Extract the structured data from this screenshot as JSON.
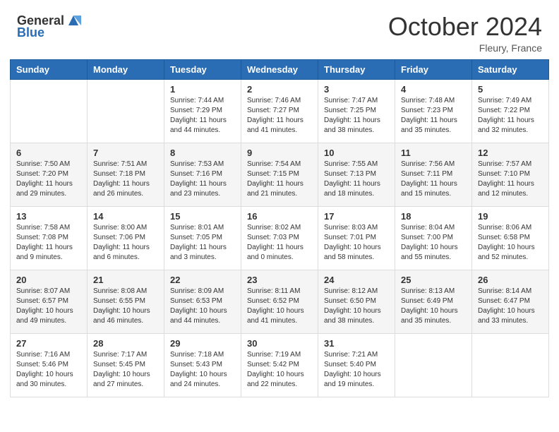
{
  "logo": {
    "general": "General",
    "blue": "Blue"
  },
  "header": {
    "month": "October 2024",
    "location": "Fleury, France"
  },
  "weekdays": [
    "Sunday",
    "Monday",
    "Tuesday",
    "Wednesday",
    "Thursday",
    "Friday",
    "Saturday"
  ],
  "weeks": [
    [
      {
        "day": "",
        "sunrise": "",
        "sunset": "",
        "daylight": ""
      },
      {
        "day": "",
        "sunrise": "",
        "sunset": "",
        "daylight": ""
      },
      {
        "day": "1",
        "sunrise": "Sunrise: 7:44 AM",
        "sunset": "Sunset: 7:29 PM",
        "daylight": "Daylight: 11 hours and 44 minutes."
      },
      {
        "day": "2",
        "sunrise": "Sunrise: 7:46 AM",
        "sunset": "Sunset: 7:27 PM",
        "daylight": "Daylight: 11 hours and 41 minutes."
      },
      {
        "day": "3",
        "sunrise": "Sunrise: 7:47 AM",
        "sunset": "Sunset: 7:25 PM",
        "daylight": "Daylight: 11 hours and 38 minutes."
      },
      {
        "day": "4",
        "sunrise": "Sunrise: 7:48 AM",
        "sunset": "Sunset: 7:23 PM",
        "daylight": "Daylight: 11 hours and 35 minutes."
      },
      {
        "day": "5",
        "sunrise": "Sunrise: 7:49 AM",
        "sunset": "Sunset: 7:22 PM",
        "daylight": "Daylight: 11 hours and 32 minutes."
      }
    ],
    [
      {
        "day": "6",
        "sunrise": "Sunrise: 7:50 AM",
        "sunset": "Sunset: 7:20 PM",
        "daylight": "Daylight: 11 hours and 29 minutes."
      },
      {
        "day": "7",
        "sunrise": "Sunrise: 7:51 AM",
        "sunset": "Sunset: 7:18 PM",
        "daylight": "Daylight: 11 hours and 26 minutes."
      },
      {
        "day": "8",
        "sunrise": "Sunrise: 7:53 AM",
        "sunset": "Sunset: 7:16 PM",
        "daylight": "Daylight: 11 hours and 23 minutes."
      },
      {
        "day": "9",
        "sunrise": "Sunrise: 7:54 AM",
        "sunset": "Sunset: 7:15 PM",
        "daylight": "Daylight: 11 hours and 21 minutes."
      },
      {
        "day": "10",
        "sunrise": "Sunrise: 7:55 AM",
        "sunset": "Sunset: 7:13 PM",
        "daylight": "Daylight: 11 hours and 18 minutes."
      },
      {
        "day": "11",
        "sunrise": "Sunrise: 7:56 AM",
        "sunset": "Sunset: 7:11 PM",
        "daylight": "Daylight: 11 hours and 15 minutes."
      },
      {
        "day": "12",
        "sunrise": "Sunrise: 7:57 AM",
        "sunset": "Sunset: 7:10 PM",
        "daylight": "Daylight: 11 hours and 12 minutes."
      }
    ],
    [
      {
        "day": "13",
        "sunrise": "Sunrise: 7:58 AM",
        "sunset": "Sunset: 7:08 PM",
        "daylight": "Daylight: 11 hours and 9 minutes."
      },
      {
        "day": "14",
        "sunrise": "Sunrise: 8:00 AM",
        "sunset": "Sunset: 7:06 PM",
        "daylight": "Daylight: 11 hours and 6 minutes."
      },
      {
        "day": "15",
        "sunrise": "Sunrise: 8:01 AM",
        "sunset": "Sunset: 7:05 PM",
        "daylight": "Daylight: 11 hours and 3 minutes."
      },
      {
        "day": "16",
        "sunrise": "Sunrise: 8:02 AM",
        "sunset": "Sunset: 7:03 PM",
        "daylight": "Daylight: 11 hours and 0 minutes."
      },
      {
        "day": "17",
        "sunrise": "Sunrise: 8:03 AM",
        "sunset": "Sunset: 7:01 PM",
        "daylight": "Daylight: 10 hours and 58 minutes."
      },
      {
        "day": "18",
        "sunrise": "Sunrise: 8:04 AM",
        "sunset": "Sunset: 7:00 PM",
        "daylight": "Daylight: 10 hours and 55 minutes."
      },
      {
        "day": "19",
        "sunrise": "Sunrise: 8:06 AM",
        "sunset": "Sunset: 6:58 PM",
        "daylight": "Daylight: 10 hours and 52 minutes."
      }
    ],
    [
      {
        "day": "20",
        "sunrise": "Sunrise: 8:07 AM",
        "sunset": "Sunset: 6:57 PM",
        "daylight": "Daylight: 10 hours and 49 minutes."
      },
      {
        "day": "21",
        "sunrise": "Sunrise: 8:08 AM",
        "sunset": "Sunset: 6:55 PM",
        "daylight": "Daylight: 10 hours and 46 minutes."
      },
      {
        "day": "22",
        "sunrise": "Sunrise: 8:09 AM",
        "sunset": "Sunset: 6:53 PM",
        "daylight": "Daylight: 10 hours and 44 minutes."
      },
      {
        "day": "23",
        "sunrise": "Sunrise: 8:11 AM",
        "sunset": "Sunset: 6:52 PM",
        "daylight": "Daylight: 10 hours and 41 minutes."
      },
      {
        "day": "24",
        "sunrise": "Sunrise: 8:12 AM",
        "sunset": "Sunset: 6:50 PM",
        "daylight": "Daylight: 10 hours and 38 minutes."
      },
      {
        "day": "25",
        "sunrise": "Sunrise: 8:13 AM",
        "sunset": "Sunset: 6:49 PM",
        "daylight": "Daylight: 10 hours and 35 minutes."
      },
      {
        "day": "26",
        "sunrise": "Sunrise: 8:14 AM",
        "sunset": "Sunset: 6:47 PM",
        "daylight": "Daylight: 10 hours and 33 minutes."
      }
    ],
    [
      {
        "day": "27",
        "sunrise": "Sunrise: 7:16 AM",
        "sunset": "Sunset: 5:46 PM",
        "daylight": "Daylight: 10 hours and 30 minutes."
      },
      {
        "day": "28",
        "sunrise": "Sunrise: 7:17 AM",
        "sunset": "Sunset: 5:45 PM",
        "daylight": "Daylight: 10 hours and 27 minutes."
      },
      {
        "day": "29",
        "sunrise": "Sunrise: 7:18 AM",
        "sunset": "Sunset: 5:43 PM",
        "daylight": "Daylight: 10 hours and 24 minutes."
      },
      {
        "day": "30",
        "sunrise": "Sunrise: 7:19 AM",
        "sunset": "Sunset: 5:42 PM",
        "daylight": "Daylight: 10 hours and 22 minutes."
      },
      {
        "day": "31",
        "sunrise": "Sunrise: 7:21 AM",
        "sunset": "Sunset: 5:40 PM",
        "daylight": "Daylight: 10 hours and 19 minutes."
      },
      {
        "day": "",
        "sunrise": "",
        "sunset": "",
        "daylight": ""
      },
      {
        "day": "",
        "sunrise": "",
        "sunset": "",
        "daylight": ""
      }
    ]
  ]
}
